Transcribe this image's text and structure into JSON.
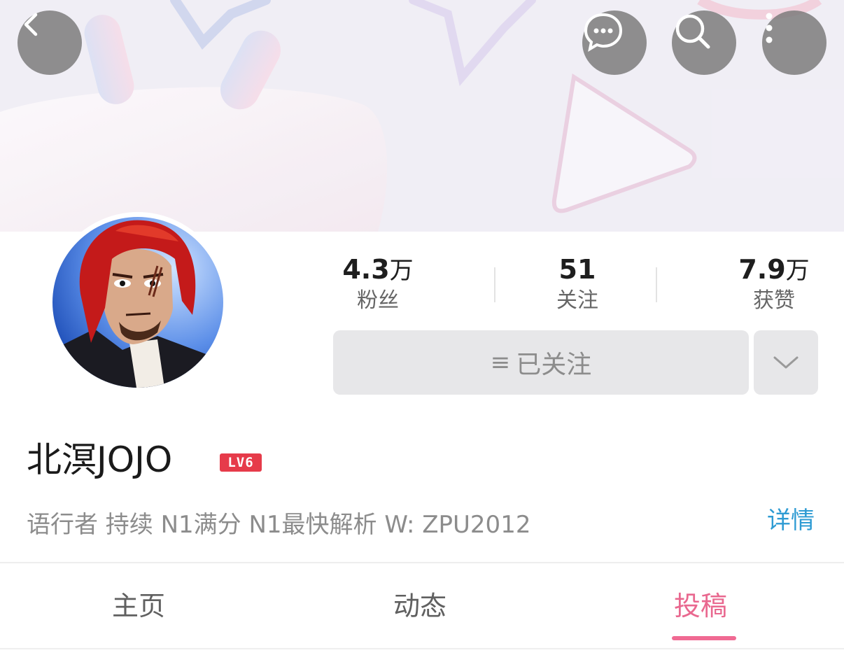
{
  "header": {
    "back_icon": "chevron-left-icon",
    "message_icon": "chat-bubble-icon",
    "search_icon": "search-icon",
    "more_icon": "more-vertical-icon"
  },
  "stats": {
    "fans": {
      "number": "4.3",
      "unit": "万",
      "label": "粉丝"
    },
    "following": {
      "number": "51",
      "unit": "",
      "label": "关注"
    },
    "likes": {
      "number": "7.9",
      "unit": "万",
      "label": "获赞"
    }
  },
  "follow_button": {
    "label": "已关注",
    "icon": "≡"
  },
  "profile": {
    "name": "北溟JOJO",
    "level": "LV6",
    "bio": "语行者 持续 N1满分 N1最快解析 W: ZPU2012",
    "detail_link": "详情"
  },
  "tabs": [
    {
      "label": "主页",
      "active": false
    },
    {
      "label": "动态",
      "active": false
    },
    {
      "label": "投稿",
      "active": true
    }
  ],
  "colors": {
    "accent_pink": "#f06a93",
    "link_blue": "#2e9bd3",
    "level_badge": "#e63b4a"
  }
}
